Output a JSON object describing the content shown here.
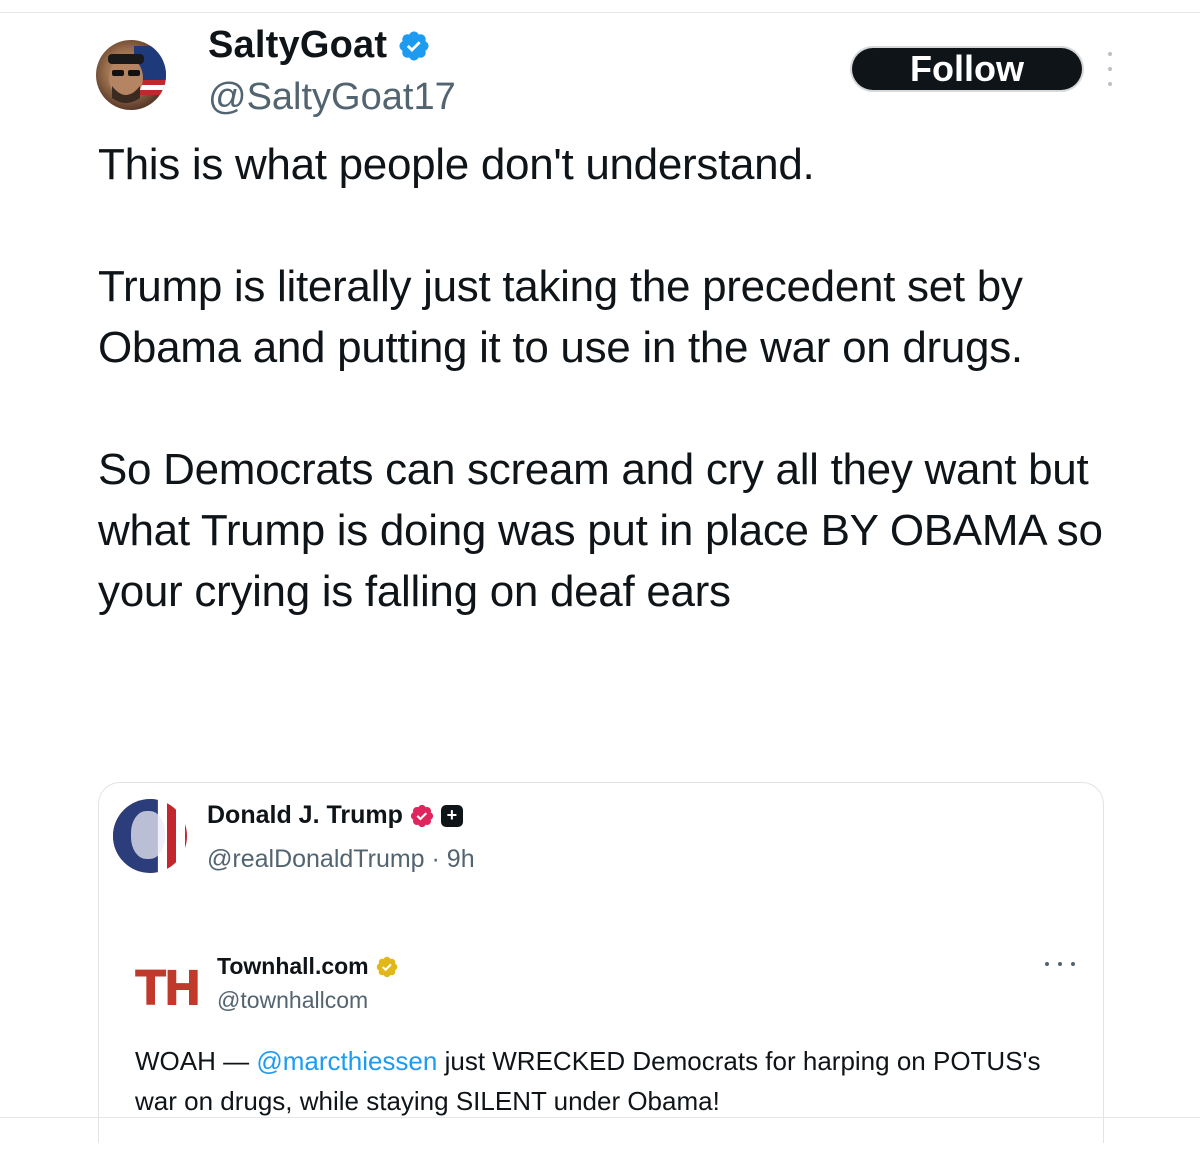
{
  "author": {
    "name": "SaltyGoat",
    "handle": "@SaltyGoat17",
    "verified_color": "#1d9bf0"
  },
  "actions": {
    "follow_label": "Follow",
    "more_icon": "more-vertical-icon"
  },
  "tweet": {
    "paragraphs": [
      "This is what people don't understand.",
      "Trump is literally just taking the precedent set by Obama and putting it to use in the war on drugs.",
      "So Democrats can scream and cry all they want but what Trump is doing was put in place BY OBAMA so your crying is falling on deaf ears"
    ]
  },
  "quoted": {
    "name": "Donald J. Trump",
    "handle": "@realDonaldTrump · 9h",
    "badge_color": "#e0245e",
    "embedded": {
      "logo_text": "TH",
      "name": "Townhall.com",
      "handle": "@townhallcom",
      "badge_color": "#e2b719",
      "text_before": "WOAH — ",
      "mention": "@marcthiessen",
      "text_after": " just WRECKED Democrats for harping on POTUS's war on drugs, while staying SILENT under Obama!"
    }
  }
}
